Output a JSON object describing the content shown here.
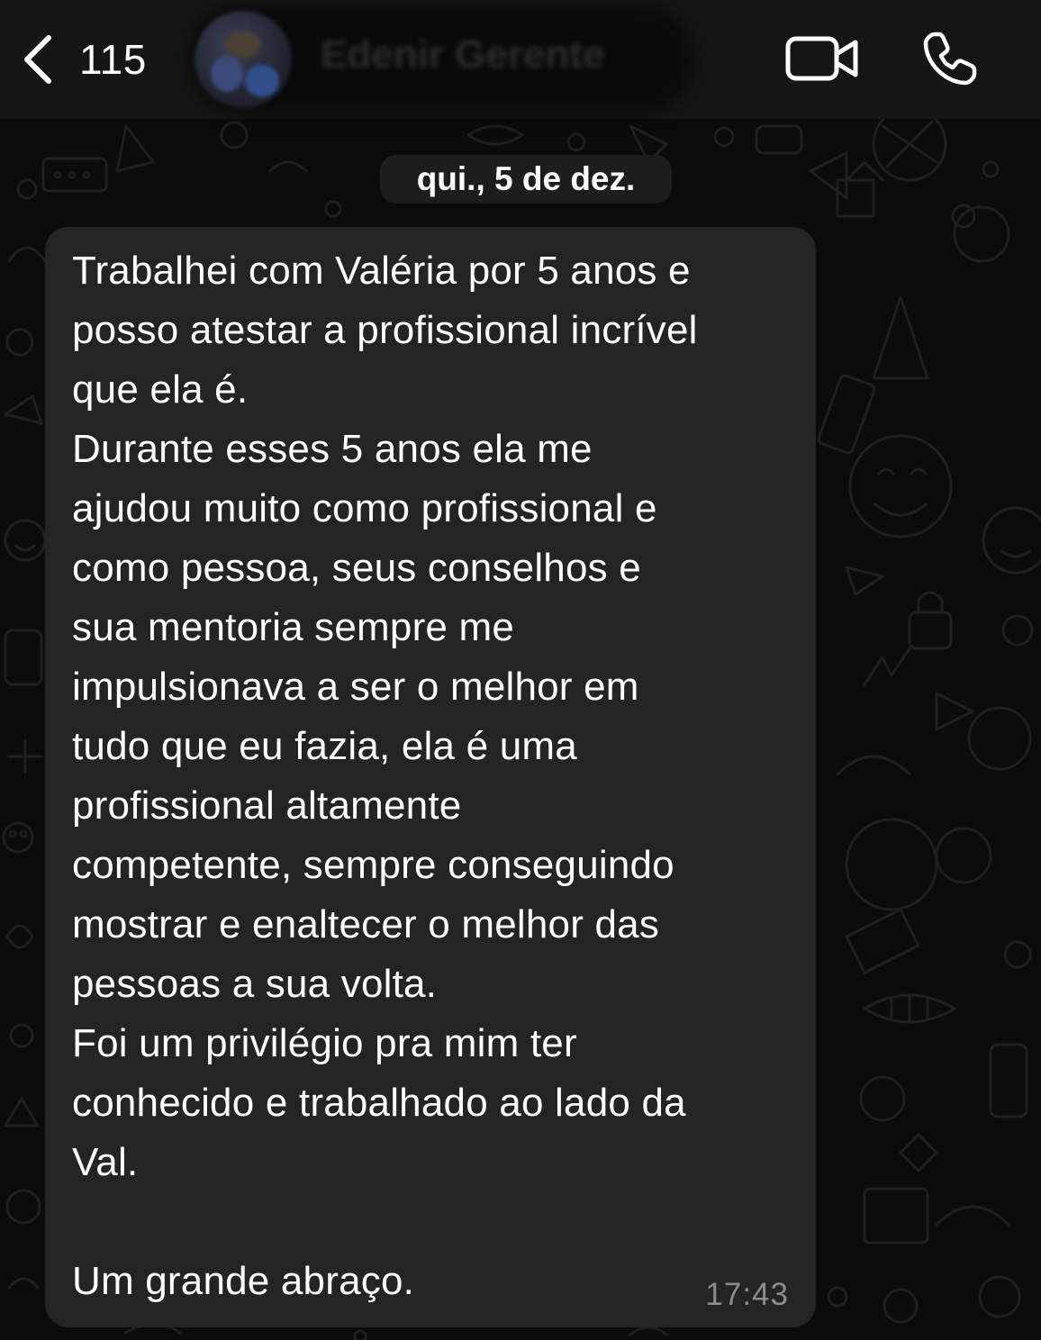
{
  "header": {
    "back_count": "115",
    "contact_name": "Edenir Gerente"
  },
  "icons": {
    "back": "chevron-left-icon",
    "video": "video-camera-icon",
    "call": "phone-icon"
  },
  "colors": {
    "background": "#0b0b0b",
    "header": "#161616",
    "bubble": "#242424",
    "date_chip": "#1d1d1d",
    "text": "#ffffff",
    "timestamp": "#8c8c8c"
  },
  "chat": {
    "date": "qui., 5 de dez.",
    "message": {
      "text": "Trabalhei com Valéria por 5 anos e\nposso atestar a profissional incrível\nque ela é.\nDurante esses 5 anos ela me\najudou muito como profissional e\ncomo pessoa, seus conselhos e\nsua mentoria sempre me\nimpulsionava a ser o melhor em\ntudo que eu fazia, ela é uma\nprofissional altamente\ncompetente, sempre conseguindo\nmostrar e enaltecer o melhor das\npessoas a sua volta.\nFoi um privilégio pra mim ter\nconhecido e trabalhado ao lado da\nVal.\n\nUm grande abraço.",
      "time": "17:43"
    }
  }
}
